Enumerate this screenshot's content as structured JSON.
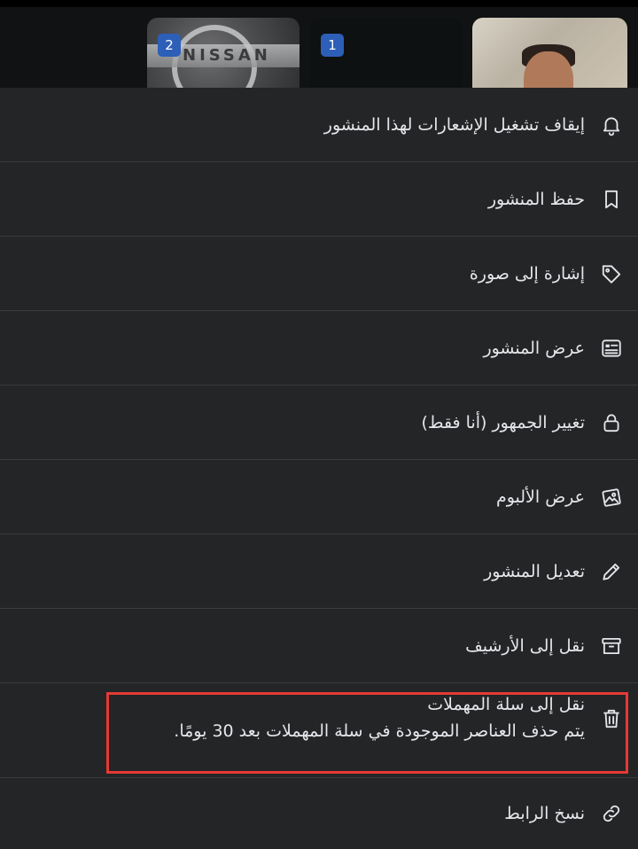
{
  "thumbnails": [
    {
      "badge": "2",
      "logo_text": "NISSAN"
    },
    {
      "badge": "1"
    },
    {}
  ],
  "menu": {
    "items": [
      {
        "label": "إيقاف تشغيل الإشعارات لهذا المنشور",
        "icon": "bell-icon"
      },
      {
        "label": "حفظ المنشور",
        "icon": "bookmark-icon"
      },
      {
        "label": "إشارة إلى صورة",
        "icon": "tag-icon"
      },
      {
        "label": "عرض المنشور",
        "icon": "post-view-icon"
      },
      {
        "label": "تغيير الجمهور (أنا فقط)",
        "icon": "lock-icon"
      },
      {
        "label": "عرض الألبوم",
        "icon": "album-icon"
      },
      {
        "label": "تعديل المنشور",
        "icon": "pencil-icon"
      },
      {
        "label": "نقل إلى الأرشيف",
        "icon": "archive-icon"
      },
      {
        "label": "نقل إلى سلة المهملات",
        "sublabel": "يتم حذف العناصر الموجودة في سلة المهملات بعد 30 يومًا.",
        "icon": "trash-icon",
        "highlighted": true
      },
      {
        "label": "نسخ الرابط",
        "icon": "link-icon"
      }
    ]
  },
  "colors": {
    "background": "#242526",
    "text": "#e4e6eb",
    "divider": "#3a3b3c",
    "highlight_border": "#e53935",
    "badge": "#2d5fb8"
  }
}
